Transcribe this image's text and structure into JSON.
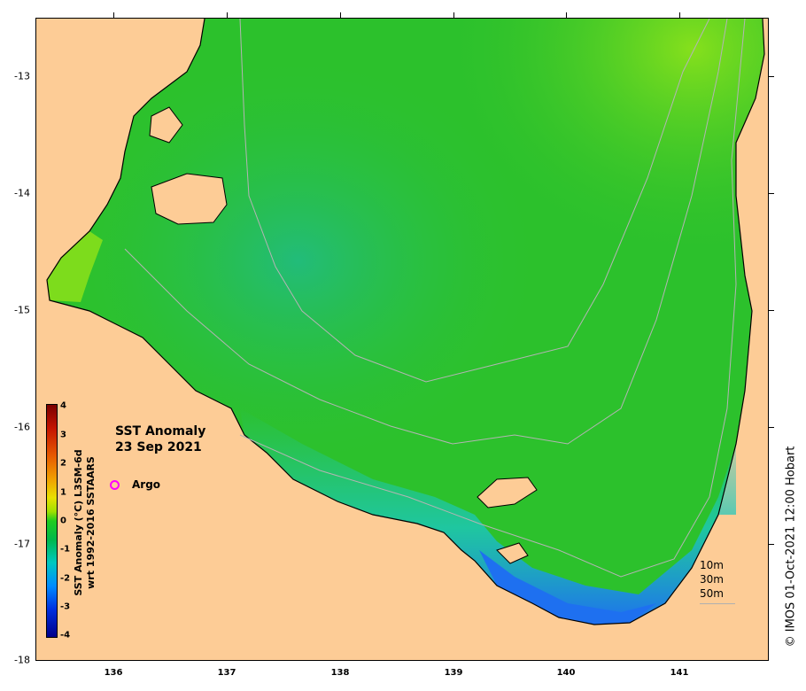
{
  "map": {
    "title": "SST Anomaly",
    "date": "23 Sep 2021",
    "legend_marker": "Argo",
    "colorbar_title_line1": "SST Anomaly (°C) L3SM-6d",
    "colorbar_title_line2": "wrt 1992-2016 SSTAARS",
    "colorbar_ticks": [
      "4",
      "3",
      "2",
      "1",
      "0",
      "-1",
      "-2",
      "-3",
      "-4"
    ],
    "x_ticks": [
      "136",
      "137",
      "138",
      "139",
      "140",
      "141"
    ],
    "y_ticks": [
      "-13",
      "-14",
      "-15",
      "-16",
      "-17",
      "-18"
    ],
    "depth_contours": [
      "10m",
      "30m",
      "50m"
    ],
    "credit": "© IMOS 01-Oct-2021 12:00 Hobart",
    "colors": {
      "land": "#fdcc96",
      "ocean_main": "#2cc12c",
      "cool": "#14c8c8",
      "cold": "#1e70f0",
      "warm": "#7ddc1c",
      "contour": "#b4b4b4",
      "argo": "#ff00ff"
    }
  }
}
